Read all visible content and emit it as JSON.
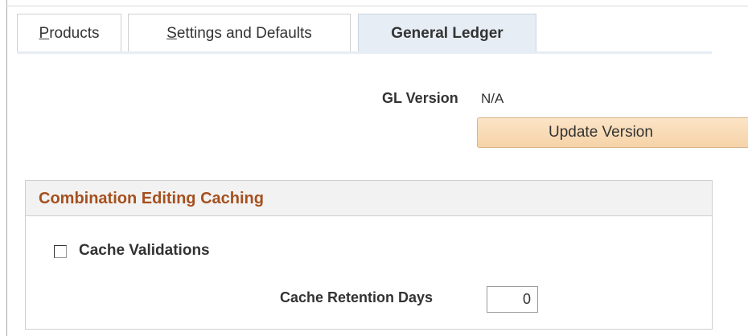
{
  "tabs": [
    {
      "label_prefix": "",
      "accesskey": "P",
      "label_rest": "roducts",
      "active": false
    },
    {
      "label_prefix": "",
      "accesskey": "S",
      "label_rest": "ettings and Defaults",
      "active": false
    },
    {
      "label": "General Ledger",
      "active": true
    }
  ],
  "gl_version": {
    "label": "GL Version",
    "value": "N/A"
  },
  "update_button": {
    "label": "Update Version"
  },
  "group": {
    "title": "Combination Editing Caching",
    "cache_validations": {
      "label": "Cache Validations",
      "checked": false
    },
    "retention": {
      "label": "Cache Retention Days",
      "value": "0"
    }
  },
  "colors": {
    "group_title": "#a5501e",
    "active_tab_bg": "#e6edf4",
    "button_bg": "#f6d3a8"
  }
}
